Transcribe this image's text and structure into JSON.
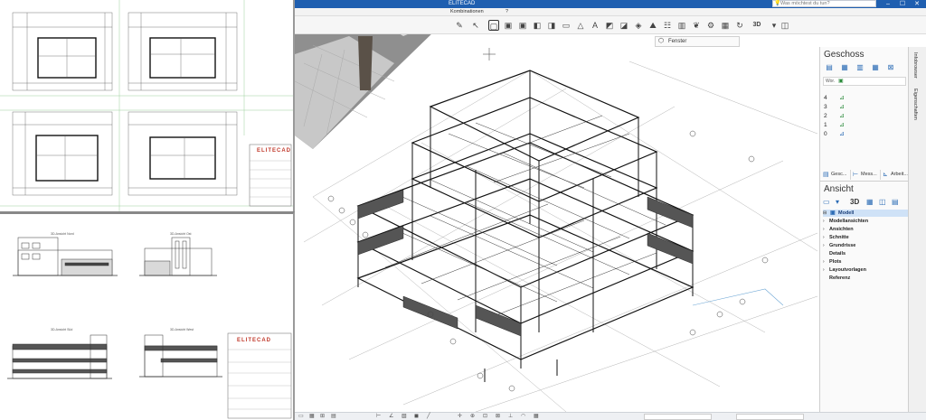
{
  "app": {
    "title": "ELITECAD",
    "search_placeholder": "Was möchtest du tun?"
  },
  "menu": {
    "combinations": "Kombinationen",
    "help": "?"
  },
  "toolbar": {
    "view_dropdown_value": "Fenster",
    "icons": [
      "eraser-icon",
      "select-box-icon",
      "image-icon",
      "image-icon",
      "cube-icon",
      "cube-icon",
      "rectangle-icon",
      "cone-icon",
      "text-icon",
      "shape-icon",
      "shape-icon",
      "surface-icon",
      "landscape-icon",
      "ladder-icon",
      "wall-icon",
      "plant-icon",
      "gear-icon",
      "table-icon",
      "rotate-icon",
      "3d-rotate-icon",
      "camera-icon"
    ],
    "rotate_3d_label": "3D"
  },
  "geschoss_panel": {
    "title": "Geschoss",
    "floors": [
      "4",
      "3",
      "2",
      "1",
      "0"
    ],
    "column_label": "Wor.",
    "tabs": [
      "Gesc...",
      "Mess...",
      "Arbeit..."
    ]
  },
  "ansicht_panel": {
    "title": "Ansicht",
    "mode_label": "3D",
    "tree": [
      {
        "label": "Modell",
        "selected": true
      },
      {
        "label": "Modellansichten"
      },
      {
        "label": "Ansichten"
      },
      {
        "label": "Schnitte"
      },
      {
        "label": "Grundrisse"
      },
      {
        "label": "Details"
      },
      {
        "label": "Plots"
      },
      {
        "label": "Layoutvorlagen"
      },
      {
        "label": "Referenz"
      }
    ]
  },
  "side_tabs": {
    "top": [
      "Infobrowser",
      "Eigenschaften"
    ]
  },
  "drawing_sheets": {
    "logo_text": "ELITECAD",
    "elevation_titles": [
      "3D-Ansicht Nord",
      "3D-Ansicht Ost",
      "3D-Ansicht Süd",
      "3D-Ansicht West"
    ]
  },
  "colors": {
    "titlebar": "#1f5fb0",
    "accent": "#2a6bb5",
    "logo_red": "#c0392b",
    "selection": "#cfe2f7"
  }
}
